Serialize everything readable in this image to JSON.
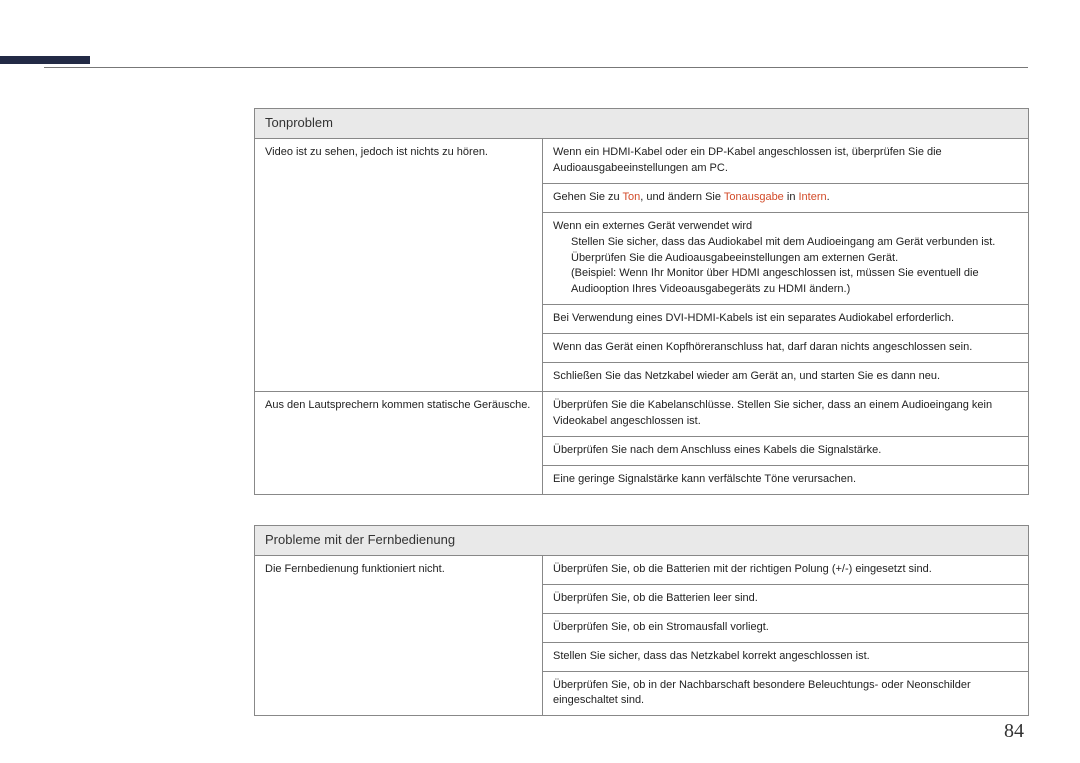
{
  "page_number": "84",
  "t1": {
    "header": "Tonproblem",
    "r1": {
      "label": "Video ist zu sehen, jedoch ist nichts zu hören.",
      "c1": "Wenn ein HDMI-Kabel oder ein DP-Kabel angeschlossen ist, überprüfen Sie die Audioausgabeeinstellungen am PC.",
      "c2_pre": "Gehen Sie zu ",
      "c2_h1": "Ton",
      "c2_mid": ", und ändern Sie ",
      "c2_h2": "Tonausgabe",
      "c2_mid2": " in ",
      "c2_h3": "Intern",
      "c2_post": ".",
      "c3_lead": "Wenn ein externes Gerät verwendet wird",
      "c3_b1": "Stellen Sie sicher, dass das Audiokabel mit dem Audioeingang am Gerät verbunden ist.",
      "c3_b2": "Überprüfen Sie die Audioausgabeeinstellungen am externen Gerät.",
      "c3_b2_note": "(Beispiel: Wenn Ihr Monitor über HDMI angeschlossen ist, müssen Sie eventuell die Audiooption Ihres Videoausgabegeräts zu HDMI ändern.)",
      "c4": "Bei Verwendung eines DVI-HDMI-Kabels ist ein separates Audiokabel erforderlich.",
      "c5": "Wenn das Gerät einen Kopfhöreranschluss hat, darf daran nichts angeschlossen sein.",
      "c6": "Schließen Sie das Netzkabel wieder am Gerät an, und starten Sie es dann neu."
    },
    "r2": {
      "label": "Aus den Lautsprechern kommen statische Geräusche.",
      "c1": "Überprüfen Sie die Kabelanschlüsse. Stellen Sie sicher, dass an einem Audioeingang kein Videokabel angeschlossen ist.",
      "c2": "Überprüfen Sie nach dem Anschluss eines Kabels die Signalstärke.",
      "c3": "Eine geringe Signalstärke kann verfälschte Töne verursachen."
    }
  },
  "t2": {
    "header": "Probleme mit der Fernbedienung",
    "r1": {
      "label": "Die Fernbedienung funktioniert nicht.",
      "c1": "Überprüfen Sie, ob die Batterien mit der richtigen Polung (+/-) eingesetzt sind.",
      "c2": "Überprüfen Sie, ob die Batterien leer sind.",
      "c3": "Überprüfen Sie, ob ein Stromausfall vorliegt.",
      "c4": "Stellen Sie sicher, dass das Netzkabel korrekt angeschlossen ist.",
      "c5": "Überprüfen Sie, ob in der Nachbarschaft besondere Beleuchtungs- oder Neonschilder eingeschaltet sind."
    }
  }
}
